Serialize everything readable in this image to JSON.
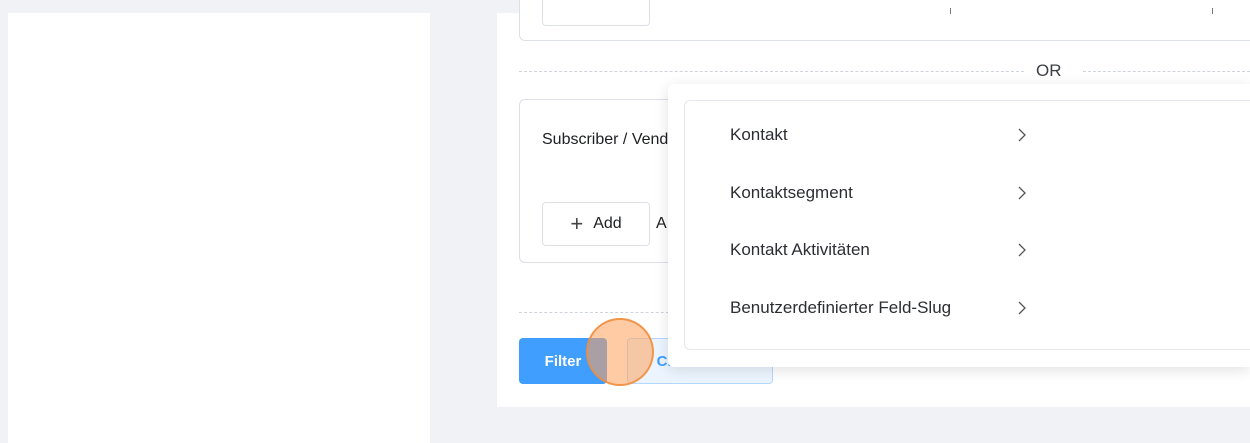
{
  "filter_group": {
    "separator_label": "OR",
    "group_label": "Subscriber / Vendor",
    "add_label": "Add",
    "partial_text": "A"
  },
  "actions": {
    "filter_label": "Filter",
    "clear_label": "Clear Filters"
  },
  "dropdown": {
    "items": [
      {
        "label": "Kontakt",
        "icon": "chevron-right-icon"
      },
      {
        "label": "Kontaktsegment",
        "icon": "chevron-right-icon"
      },
      {
        "label": "Kontakt Aktivitäten",
        "icon": "chevron-right-icon"
      },
      {
        "label": "Benutzerdefinierter Feld-Slug",
        "icon": "chevron-right-icon"
      }
    ]
  },
  "colors": {
    "primary": "#409eff",
    "click_indicator": "#ffa05a"
  }
}
